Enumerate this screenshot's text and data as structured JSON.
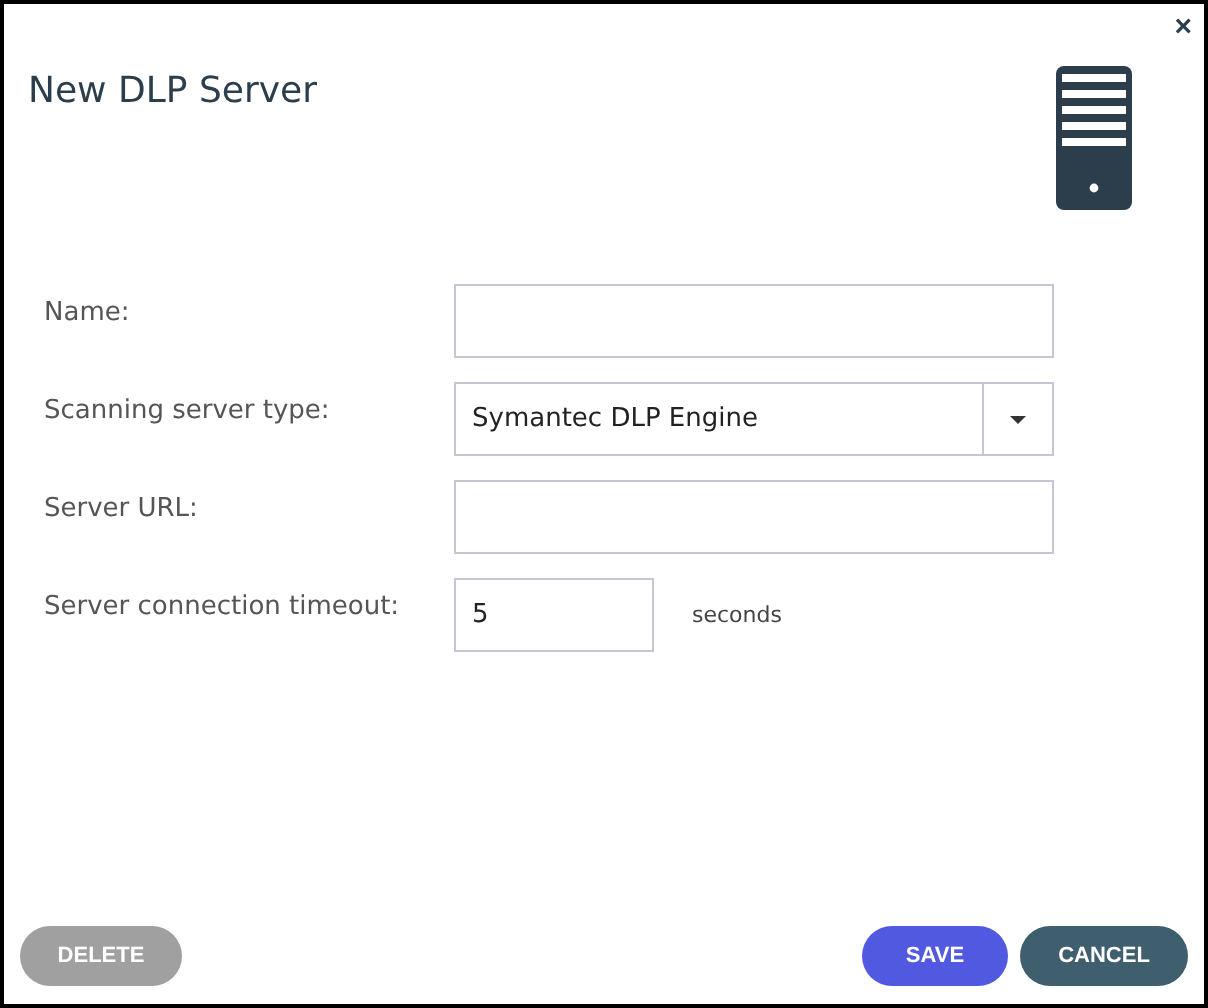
{
  "dialog": {
    "title": "New DLP Server",
    "close": "×"
  },
  "fields": [
    {
      "kind": "text",
      "label": "Name:"
    },
    {
      "kind": "select",
      "label": "Scanning server type:",
      "value": "Symantec DLP Engine"
    },
    {
      "kind": "text",
      "label": "Server URL:"
    },
    {
      "kind": "number",
      "label": "Server connection timeout:",
      "value": "5",
      "unit": "seconds"
    }
  ],
  "buttons": [
    {
      "kind": "delete",
      "label": "DELETE"
    },
    {
      "kind": "save",
      "label": "SAVE"
    },
    {
      "kind": "cancel",
      "label": "CANCEL"
    }
  ]
}
